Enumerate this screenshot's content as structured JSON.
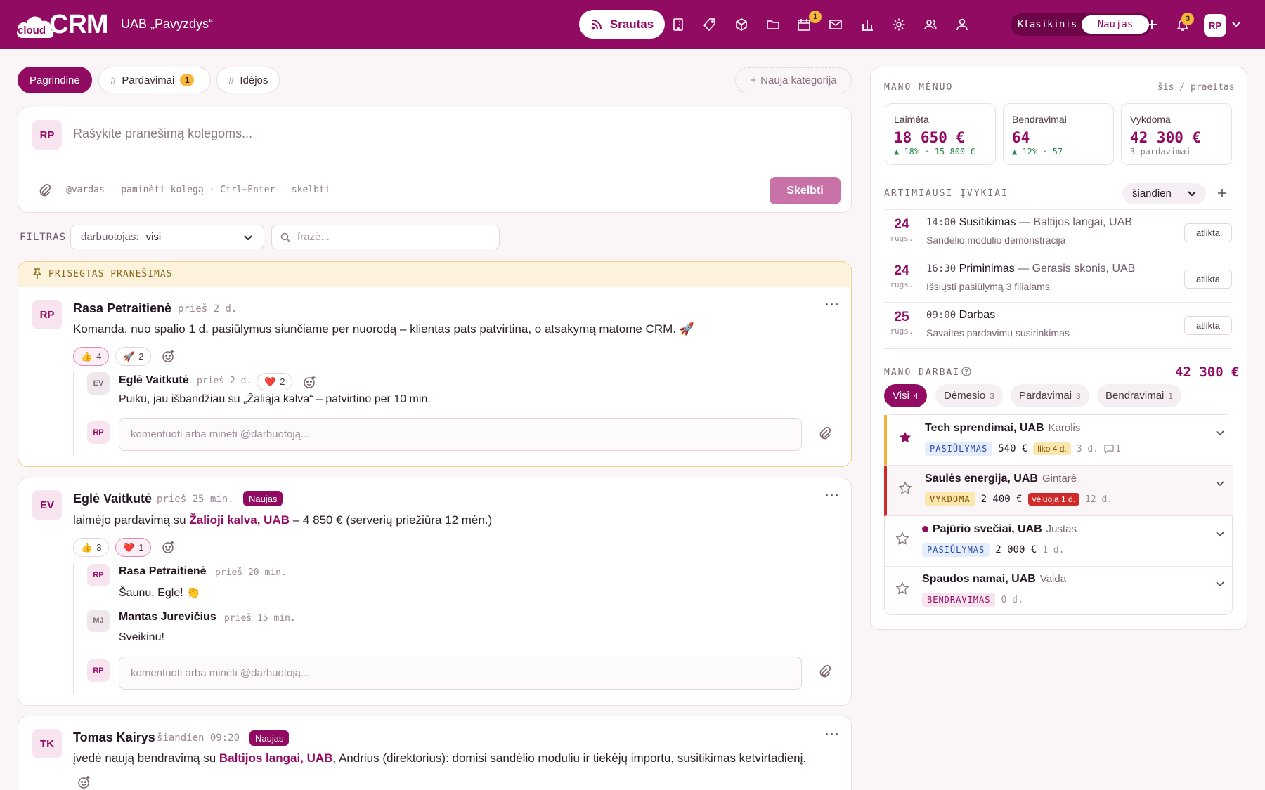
{
  "topbar": {
    "logo_small": "cloud",
    "logo_big": "CRM",
    "company": "UAB „Pavyzdys“",
    "nav_active": "Srautas",
    "nav_icons": [
      "building-icon",
      "tag-icon",
      "box-icon",
      "folder-icon",
      "calendar-icon",
      "mail-icon",
      "chart-icon",
      "gear-icon",
      "users-icon",
      "user-icon"
    ],
    "calendar_badge": "1",
    "view_classic": "Klasikinis",
    "view_new": "Naujas",
    "notifications_badge": "3",
    "avatar": "RP",
    "brand_color": "#920b62"
  },
  "tabs": [
    {
      "label": "Pagrindinė",
      "active": true
    },
    {
      "label": "Pardavimai",
      "count": "1"
    },
    {
      "label": "Idėjos"
    }
  ],
  "new_category": "Nauja kategorija",
  "composer": {
    "avatar": "RP",
    "placeholder": "Rašykite pranešimą kolegoms...",
    "hint": "@vardas — paminėti kolegą · Ctrl+Enter — skelbti",
    "submit": "Skelbti"
  },
  "filters": {
    "label": "FILTRAS",
    "employee_key": "darbuotojas:",
    "employee_value": "visi",
    "search_placeholder": "frazė..."
  },
  "pinned": {
    "header": "PRISEGTAS PRANEŠIMAS",
    "avatar": "RP",
    "author": "Rasa Petraitienė",
    "time": "prieš 2 d.",
    "text": "Komanda, nuo spalio 1 d. pasiūlymus siunčiame per nuorodą – klientas pats patvirtina, o atsakymą matome CRM. 🚀",
    "reactions": [
      {
        "emoji": "👍",
        "count": "4"
      },
      {
        "emoji": "🚀",
        "count": "2"
      }
    ],
    "reply": {
      "avatar": "EV",
      "author": "Eglė Vaitkutė",
      "time": "prieš 2 d.",
      "reaction_emoji": "❤️",
      "reaction_count": "2",
      "text": "Puiku, jau išbandžiau su „Žaliąja kalva“ – patvirtino per 10 min."
    },
    "comment_avatar": "RP",
    "comment_placeholder": "komentuoti arba minėti @darbuotoją..."
  },
  "post2": {
    "avatar": "EV",
    "author": "Eglė Vaitkutė",
    "time": "prieš 25 min.",
    "badge": "Naujas",
    "text_pre": "laimėjo pardavimą su ",
    "text_link": "Žalioji kalva, UAB",
    "text_post": " – 4 850 € (serverių priežiūra 12 mėn.)",
    "reactions": [
      {
        "emoji": "👍",
        "count": "3"
      },
      {
        "emoji": "❤️",
        "count": "1"
      }
    ],
    "replies": [
      {
        "avatar": "RP",
        "author": "Rasa Petraitienė",
        "time": "prieš 20 min.",
        "text": "Šaunu, Egle! 👏"
      },
      {
        "avatar": "MJ",
        "author": "Mantas Jurevičius",
        "time": "prieš 15 min.",
        "text": "Sveikinu!"
      }
    ],
    "comment_avatar": "RP",
    "comment_placeholder": "komentuoti arba minėti @darbuotoją..."
  },
  "post3": {
    "avatar": "TK",
    "author": "Tomas Kairys",
    "time": "šiandien 09:20",
    "badge": "Naujas",
    "text_pre": "įvedė naują bendravimą su ",
    "text_link": "Baltijos langai, UAB",
    "text_post": ", Andrius (direktorius): domisi sandėlio moduliu ir tiekėjų importu, susitikimas ketvirtadienį."
  },
  "month": {
    "title": "MANO MĖNUO",
    "period": "šis / praeitas",
    "stats": [
      {
        "label": "Laimėta",
        "value": "18 650 €",
        "delta": "▲ 18% · 15 800 €"
      },
      {
        "label": "Bendravimai",
        "value": "64",
        "delta": "▲ 12% · 57"
      },
      {
        "label": "Vykdoma",
        "value": "42 300 €",
        "delta": "3 pardavimai"
      }
    ]
  },
  "events": {
    "title": "ARTIMIAUSI ĮVYKIAI",
    "range": "šiandien",
    "items": [
      {
        "day": "24",
        "month": "rugs.",
        "time": "14:00",
        "title": "Susitikimas",
        "company": " — Baltijos langai, UAB",
        "desc": "Sandėlio modulio demonstracija",
        "action": "atlikta"
      },
      {
        "day": "24",
        "month": "rugs.",
        "time": "16:30",
        "title": "Priminimas",
        "company": " — Gerasis skonis, UAB",
        "desc": "Išsiųsti pasiūlymą 3 filialams",
        "action": "atlikta"
      },
      {
        "day": "25",
        "month": "rugs.",
        "time": "09:00",
        "title": "Darbas",
        "company": "",
        "desc": "Savaitės pardavimų susirinkimas",
        "action": "atlikta"
      }
    ]
  },
  "work": {
    "title": "MANO DARBAI",
    "total": "42 300 €",
    "tabs": [
      {
        "label": "Visi",
        "count": "4"
      },
      {
        "label": "Dėmesio",
        "count": "3"
      },
      {
        "label": "Pardavimai",
        "count": "3"
      },
      {
        "label": "Bendravimai",
        "count": "1"
      }
    ],
    "items": [
      {
        "company": "Tech sprendimai, UAB",
        "person": "Karolis",
        "tag": "PASIŪLYMAS",
        "amount": "540 €",
        "flag": "liko 4 d.",
        "age": "3 d.",
        "comments": "1"
      },
      {
        "company": "Saulės energija, UAB",
        "person": "Gintarė",
        "tag": "VYKDOMA",
        "amount": "2 400 €",
        "flag": "vėluoja 1 d.",
        "age": "12 d."
      },
      {
        "company": "Pajūrio svečiai, UAB",
        "person": "Justas",
        "tag": "PASIŪLYMAS",
        "amount": "2 000 €",
        "age": "1 d."
      },
      {
        "company": "Spaudos namai, UAB",
        "person": "Vaida",
        "tag": "BENDRAVIMAS",
        "age": "0 d."
      }
    ]
  }
}
